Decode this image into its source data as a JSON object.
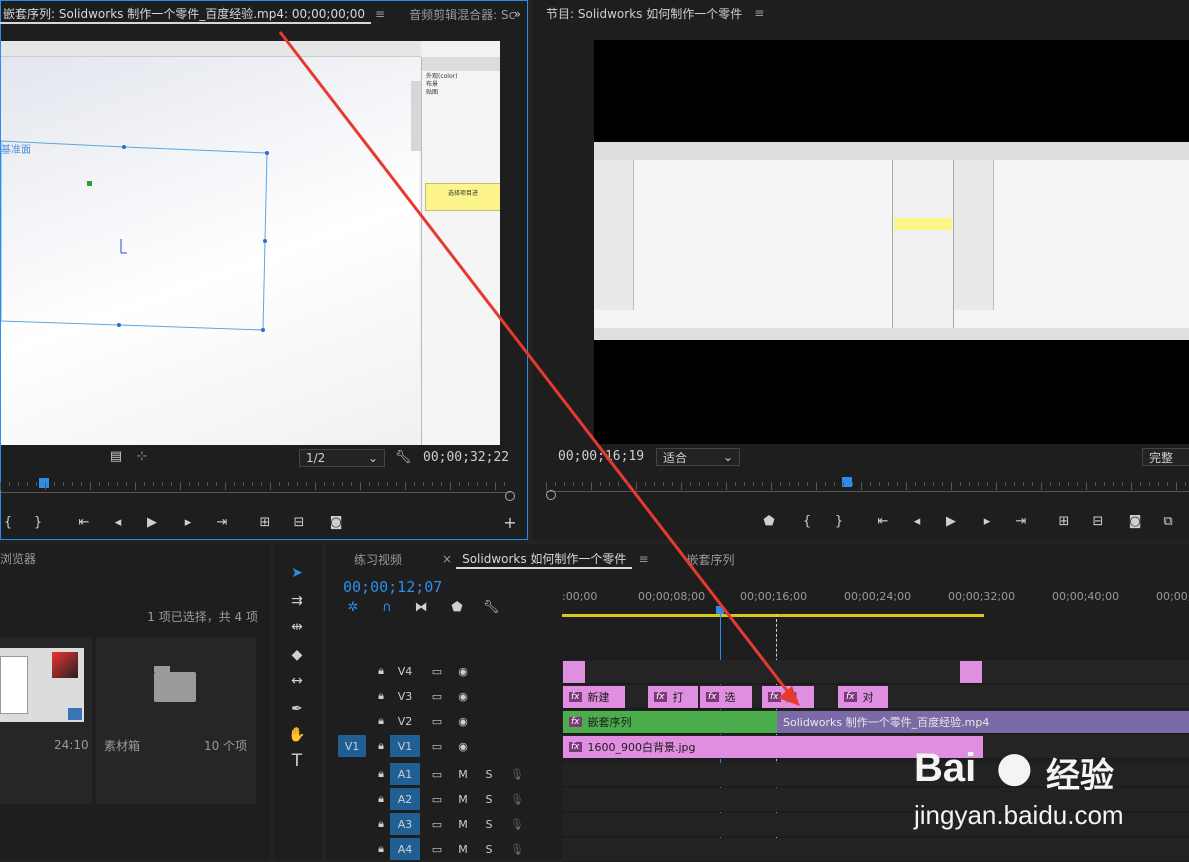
{
  "source_monitor": {
    "tabs": [
      "嵌套序列: Solidworks 制作一个零件_百度经验.mp4: 00;00;00;00",
      "音频剪辑混合器: Sc"
    ],
    "menu_icon": "≡",
    "chevron": "»",
    "scale_select": "1/2",
    "timecode": "00;00;32;22",
    "controls": [
      "{",
      "}",
      "⇤",
      "◂",
      "▶",
      "▸",
      "⇥",
      "insert",
      "overwrite",
      "camera"
    ],
    "plus": "+",
    "sw_sketch_label": "基准面",
    "sw_tree": [
      "外观(color)",
      "布景",
      "贴图"
    ],
    "sw_hint": "选择项目进"
  },
  "program_monitor": {
    "title": "节目: Solidworks 如何制作一个零件",
    "menu_icon": "≡",
    "timecode": "00;00;16;19",
    "fit_select": "适合",
    "full_select": "完整"
  },
  "project_panel": {
    "title": "浏览器",
    "selection_info": "1 项已选择，共 4 项",
    "items": [
      {
        "name": "",
        "duration": "24:10"
      },
      {
        "name": "素材箱",
        "count": "10 个项"
      }
    ]
  },
  "timeline": {
    "tabs": [
      "练习视频",
      "×",
      "Solidworks 如何制作一个零件",
      "≡",
      "嵌套序列"
    ],
    "timecode": "00;00;12;07",
    "ruler_labels": [
      ":00;00",
      "00;00;08;00",
      "00;00;16;00",
      "00;00;24;00",
      "00;00;32;00",
      "00;00;40;00",
      "00;00;4"
    ],
    "video_tracks": [
      {
        "name": "V4",
        "src": ""
      },
      {
        "name": "V3",
        "src": ""
      },
      {
        "name": "V2",
        "src": ""
      },
      {
        "name": "V1",
        "src": "V1"
      }
    ],
    "audio_tracks": [
      {
        "name": "A1",
        "m": "M",
        "s": "S"
      },
      {
        "name": "A2",
        "m": "M",
        "s": "S"
      },
      {
        "name": "A3",
        "m": "M",
        "s": "S"
      },
      {
        "name": "A4",
        "m": "M",
        "s": "S"
      }
    ],
    "v3_clips": [
      "新建",
      "打",
      "选",
      "用",
      "对"
    ],
    "v2_clips": [
      "嵌套序列",
      "Solidworks 制作一个零件_百度经验.mp4"
    ],
    "v1_clip": "1600_900白背景.jpg"
  },
  "watermark": {
    "brand": "Bai",
    "brand2": "经验",
    "url": "jingyan.baidu.com"
  },
  "colors": {
    "accent_blue": "#2d8ceb",
    "clip_pink": "#e08fe0",
    "clip_green": "#4cad4c",
    "clip_purple": "#7b6aa5",
    "arrow_red": "#e53a2f"
  }
}
